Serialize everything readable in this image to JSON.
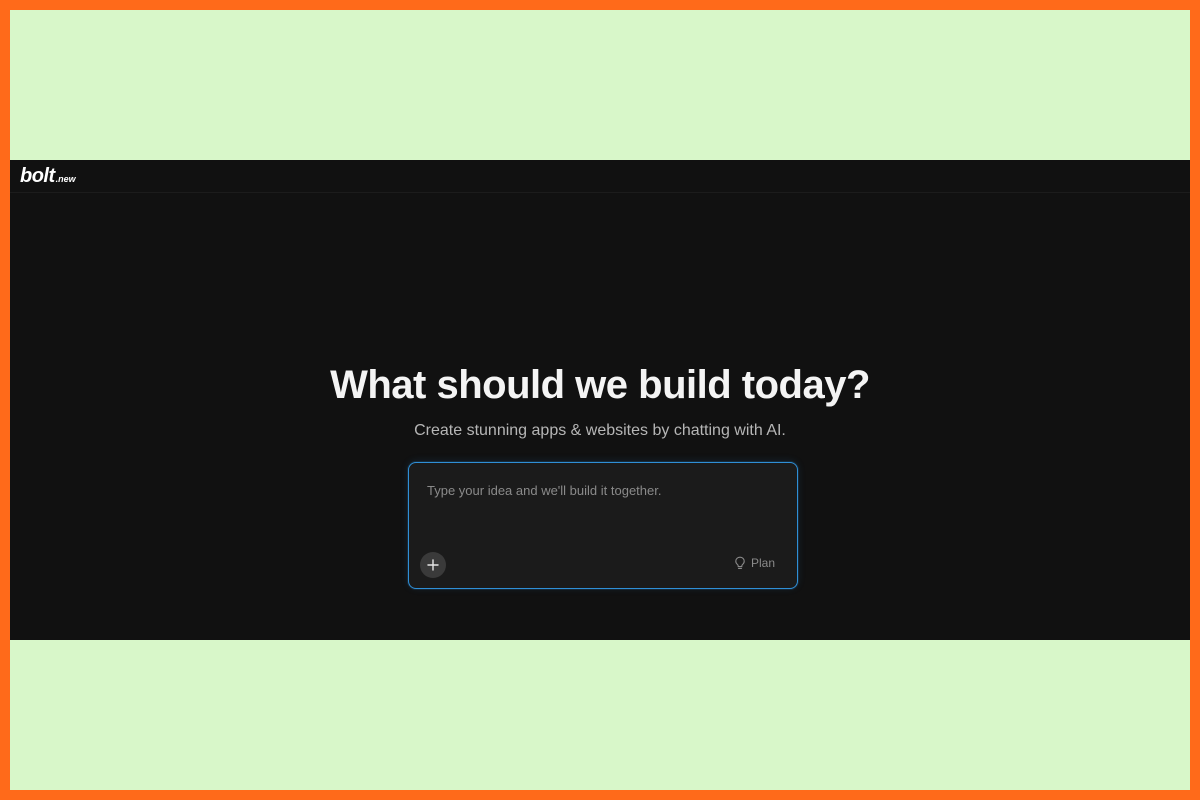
{
  "header": {
    "logo_main": "bolt",
    "logo_sub": ".new"
  },
  "hero": {
    "title": "What should we build today?",
    "subtitle": "Create stunning apps & websites by chatting with AI."
  },
  "prompt": {
    "placeholder": "Type your idea and we'll build it together.",
    "value": "",
    "add_icon": "plus-icon",
    "plan_icon": "lightbulb-icon",
    "plan_label": "Plan"
  },
  "colors": {
    "frame_border": "#ff6a1a",
    "frame_background": "#d8f7c9",
    "app_background": "#111111",
    "prompt_border": "#2f8fd6"
  }
}
